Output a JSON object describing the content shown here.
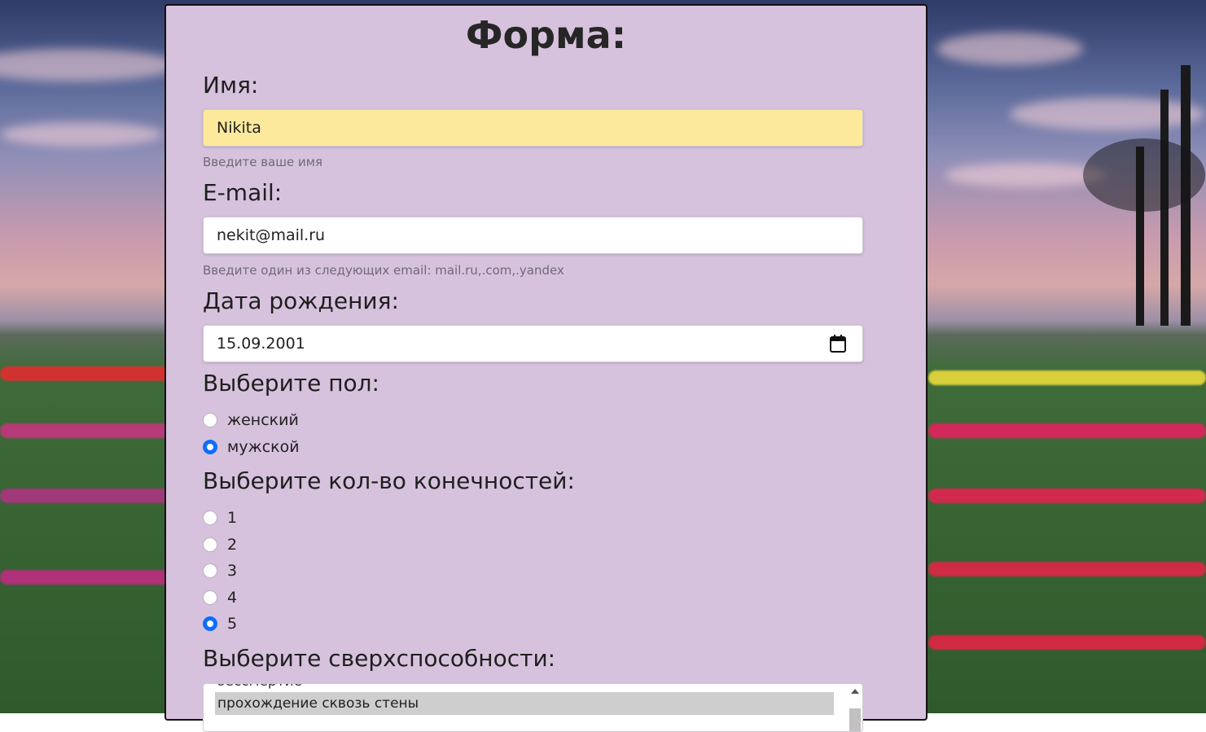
{
  "form": {
    "title": "Форма:",
    "name": {
      "label": "Имя:",
      "value": "Nikita",
      "hint": "Введите ваше имя"
    },
    "email": {
      "label": "E-mail:",
      "value": "nekit@mail.ru",
      "hint": "Введите один из следующих email: mail.ru,.com,.yandex"
    },
    "birthdate": {
      "label": "Дата рождения:",
      "value": "15.09.2001",
      "icon": "calendar-icon"
    },
    "gender": {
      "label": "Выберите пол:",
      "options": [
        {
          "label": "женский",
          "checked": false
        },
        {
          "label": "мужской",
          "checked": true
        }
      ]
    },
    "limbs": {
      "label": "Выберите кол-во конечностей:",
      "options": [
        {
          "label": "1",
          "checked": false
        },
        {
          "label": "2",
          "checked": false
        },
        {
          "label": "3",
          "checked": false
        },
        {
          "label": "4",
          "checked": false
        },
        {
          "label": "5",
          "checked": true
        }
      ]
    },
    "abilities": {
      "label": "Выберите сверхспособности:",
      "options_visible": [
        "бессмертие",
        "прохождение сквозь стены"
      ],
      "selected": "прохождение сквозь стены"
    }
  },
  "colors": {
    "panel_bg": "#d7c2dd",
    "autofill_bg": "#fde99c",
    "accent": "#0d6efd"
  }
}
